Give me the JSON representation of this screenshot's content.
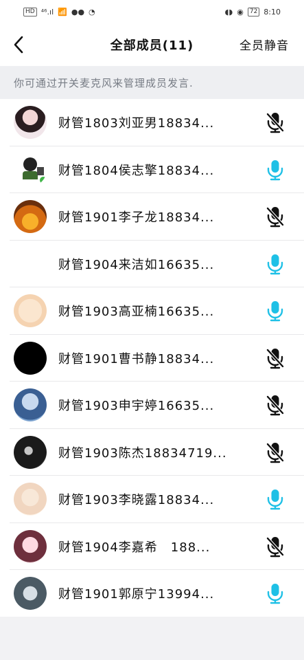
{
  "status": {
    "left_chip": "HD",
    "signal": "⁴⁶.ıl",
    "battery": "72",
    "time": "8:10"
  },
  "header": {
    "title": "全部成员(11)",
    "right_action": "全员静音"
  },
  "hint": "你可通过开关麦克风来管理成员发言.",
  "members": [
    {
      "name": "财管1803刘亚男18834...",
      "mic": "muted",
      "avatar": "pink"
    },
    {
      "name": "财管1804侯志擎18834...",
      "mic": "on",
      "avatar": "cartoon",
      "badge": true
    },
    {
      "name": "财管1901李子龙18834...",
      "mic": "muted",
      "avatar": "sunset"
    },
    {
      "name": "财管1904来洁如16635...",
      "mic": "on",
      "avatar": "none"
    },
    {
      "name": "财管1903高亚楠16635...",
      "mic": "on",
      "avatar": "anime"
    },
    {
      "name": "财管1901曹书静18834...",
      "mic": "muted",
      "avatar": "black"
    },
    {
      "name": "财管1903申宇婷16635...",
      "mic": "muted",
      "avatar": "blue"
    },
    {
      "name": "财管1903陈杰18834719...",
      "mic": "muted",
      "avatar": "dark"
    },
    {
      "name": "财管1903李晓露18834...",
      "mic": "on",
      "avatar": "light"
    },
    {
      "name": "财管1904李嘉希　188...",
      "mic": "muted",
      "avatar": "doll"
    },
    {
      "name": "财管1901郭原宁13994...",
      "mic": "on",
      "avatar": "portrait"
    }
  ],
  "colors": {
    "mic_on": "#1ec0e6",
    "mic_muted": "#111111"
  }
}
